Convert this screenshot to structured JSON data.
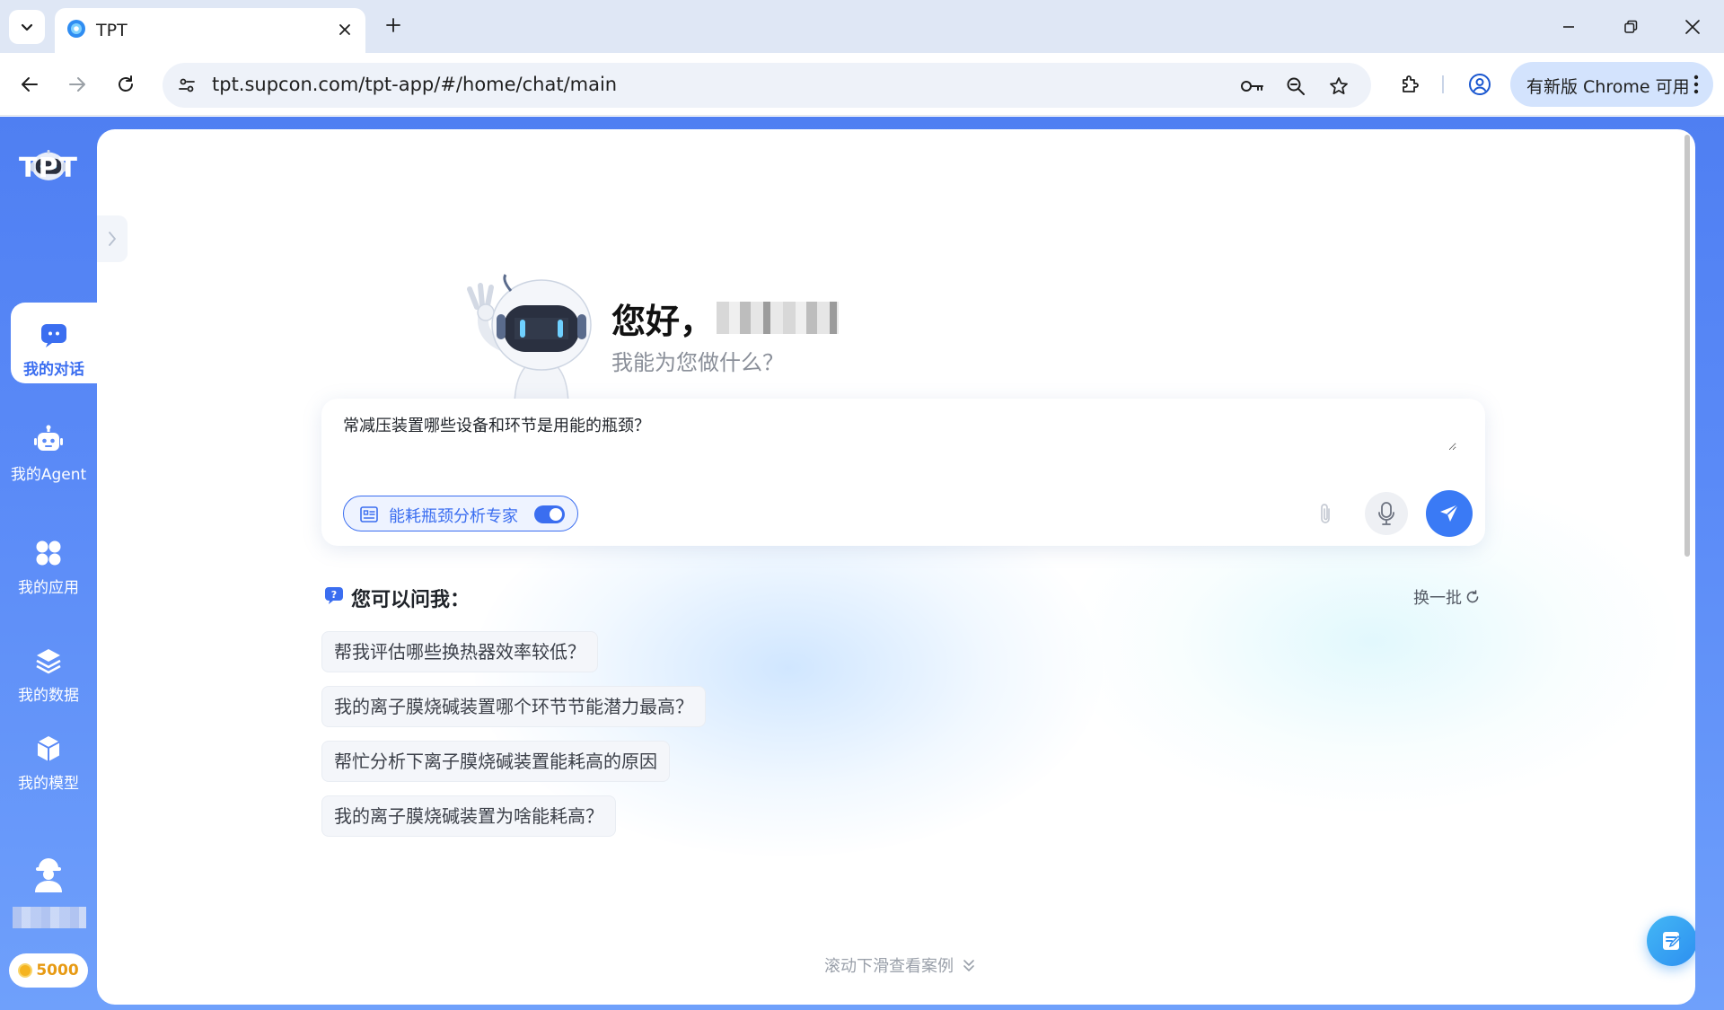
{
  "browser": {
    "tab_title": "TPT",
    "url": "tpt.supcon.com/tpt-app/#/home/chat/main",
    "update_label": "有新版 Chrome 可用"
  },
  "sidebar": {
    "logo_text": "TPT",
    "items": [
      {
        "label": "我的对话",
        "icon": "chat-icon",
        "active": true
      },
      {
        "label": "我的Agent",
        "icon": "robot-icon",
        "active": false
      },
      {
        "label": "我的应用",
        "icon": "apps-icon",
        "active": false
      },
      {
        "label": "我的数据",
        "icon": "layers-icon",
        "active": false
      },
      {
        "label": "我的模型",
        "icon": "cube-icon",
        "active": false
      }
    ],
    "points": "5000"
  },
  "main": {
    "greeting": "您好，",
    "subtitle": "我能为您做什么？",
    "input_value": "常减压装置哪些设备和环节是用能的瓶颈？",
    "agent_chip": "能耗瓶颈分析专家",
    "agent_enabled": true,
    "ask_title": "您可以问我：",
    "refresh_label": "换一批",
    "suggestions": [
      "帮我评估哪些换热器效率较低？",
      "我的离子膜烧碱装置哪个环节节能潜力最高？",
      "帮忙分析下离子膜烧碱装置能耗高的原因",
      "我的离子膜烧碱装置为啥能耗高？"
    ],
    "scroll_hint": "滚动下滑查看案例"
  },
  "colors": {
    "accent": "#3b6ef0",
    "sidebar": "#5a8af7",
    "send": "#3a7af5"
  }
}
